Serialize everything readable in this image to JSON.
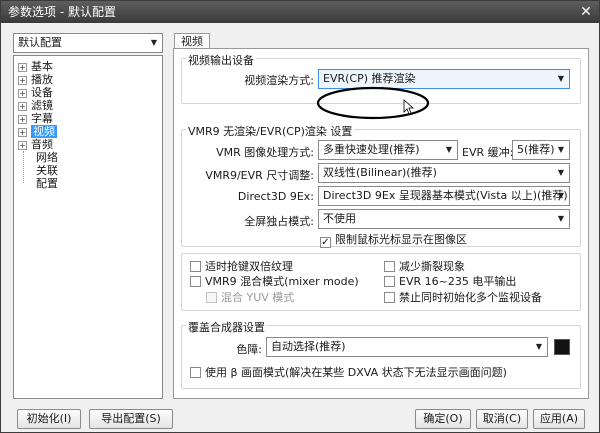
{
  "window": {
    "title": "参数选项 - 默认配置",
    "close_glyph": "✕"
  },
  "profile": {
    "selected": "默认配置"
  },
  "tree": {
    "items": [
      {
        "label": "基本"
      },
      {
        "label": "播放"
      },
      {
        "label": "设备"
      },
      {
        "label": "滤镜"
      },
      {
        "label": "字幕"
      },
      {
        "label": "视频",
        "selected": true
      },
      {
        "label": "音频"
      }
    ],
    "children": [
      {
        "label": "网络"
      },
      {
        "label": "关联"
      },
      {
        "label": "配置"
      }
    ]
  },
  "tab": {
    "label": "视频"
  },
  "video_output": {
    "group_label": "视频输出设备",
    "renderer_label": "视频渲染方式:",
    "renderer_value": "EVR(CP) 推荐渲染"
  },
  "vmr": {
    "group_label": "VMR9 无渲染/EVR(CP)渲染 设置",
    "processing_label": "VMR 图像处理方式:",
    "processing_value": "多重快速处理(推荐)",
    "buffer_label": "EVR 缓冲:",
    "buffer_value": "5(推荐)",
    "resize_label": "VMR9/EVR 尺寸调整:",
    "resize_value": "双线性(Bilinear)(推荐)",
    "d3d_label": "Direct3D 9Ex:",
    "d3d_value": "Direct3D 9Ex 呈现器基本模式(Vista 以上)(推荐)",
    "fullscreen_label": "全屏独占模式:",
    "fullscreen_value": "不使用",
    "limit_cursor": "限制鼠标光标显示在图像区"
  },
  "options": {
    "texture": "适时抢键双倍纹理",
    "reduce_tearing": "减少撕裂现象",
    "mixer": "VMR9 混合模式(mixer mode)",
    "evr_levels": "EVR 16~235 电平输出",
    "yuv": "混合 YUV 模式",
    "no_multi_monitor": "禁止同时初始化多个监视设备"
  },
  "overlay": {
    "group_label": "覆盖合成器设置",
    "color_label": "色障:",
    "color_value": "自动选择(推荐)",
    "swatch_color": "#111111",
    "beta_label": "使用 β 画面模式(解决在某些 DXVA 状态下无法显示画面问题)"
  },
  "buttons": {
    "init": "初始化(I)",
    "export": "导出配置(S)",
    "ok": "确定(O)",
    "cancel": "取消(C)",
    "apply": "应用(A)"
  },
  "glyphs": {
    "dropdown": "▼",
    "expand": "+",
    "check": "✓"
  }
}
